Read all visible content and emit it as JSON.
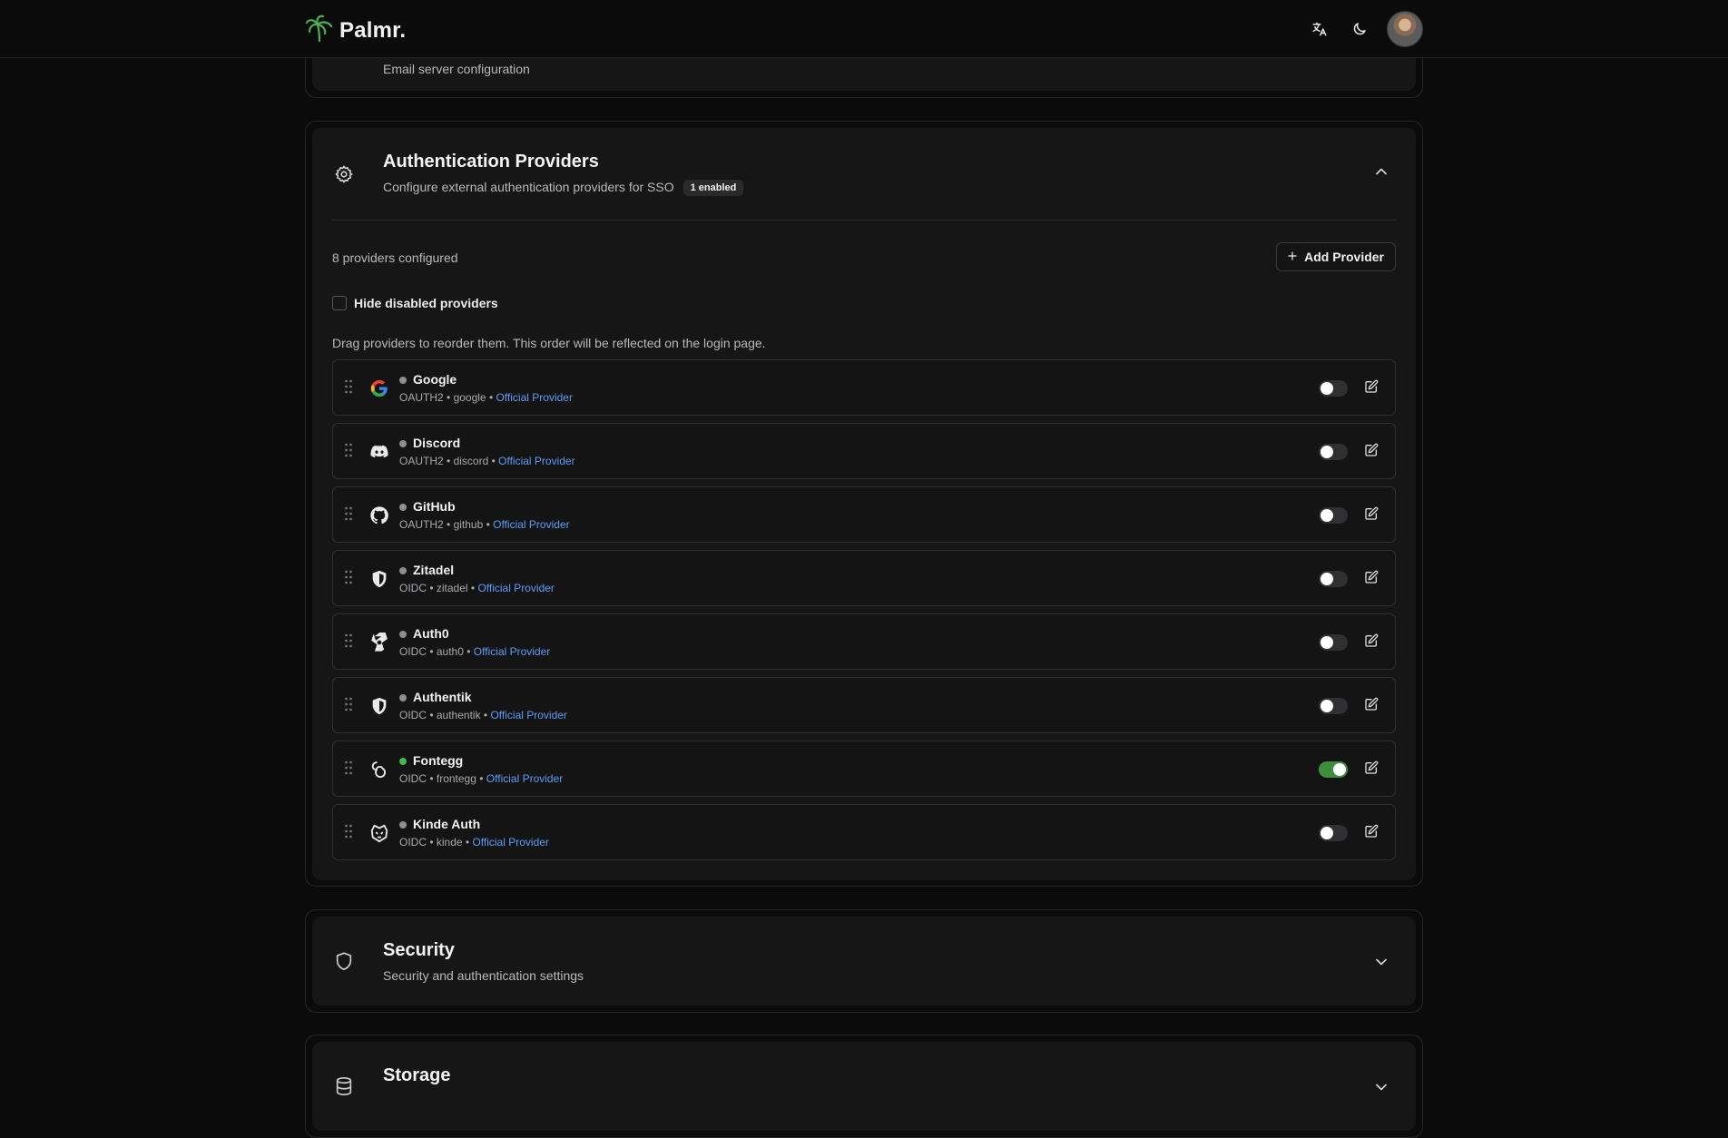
{
  "brand": {
    "name": "Palmr.",
    "logo_icon": "palm-tree-icon",
    "accent": "#4caf50"
  },
  "topbar": {
    "translate_icon": "translate-icon",
    "theme_icon": "moon-icon"
  },
  "email_section": {
    "subtitle": "Email server configuration"
  },
  "auth_section": {
    "title": "Authentication Providers",
    "subtitle": "Configure external authentication providers for SSO",
    "badge": "1 enabled",
    "count_text": "8 providers configured",
    "add_button": "Add Provider",
    "hide_disabled_label": "Hide disabled providers",
    "drag_hint": "Drag providers to reorder them. This order will be reflected on the login page.",
    "providers": [
      {
        "name": "Google",
        "protocol": "OAUTH2",
        "slug": "google",
        "link": "Official Provider",
        "icon": "google-icon",
        "enabled": false
      },
      {
        "name": "Discord",
        "protocol": "OAUTH2",
        "slug": "discord",
        "link": "Official Provider",
        "icon": "discord-icon",
        "enabled": false
      },
      {
        "name": "GitHub",
        "protocol": "OAUTH2",
        "slug": "github",
        "link": "Official Provider",
        "icon": "github-icon",
        "enabled": false
      },
      {
        "name": "Zitadel",
        "protocol": "OIDC",
        "slug": "zitadel",
        "link": "Official Provider",
        "icon": "shield-icon",
        "enabled": false
      },
      {
        "name": "Auth0",
        "protocol": "OIDC",
        "slug": "auth0",
        "link": "Official Provider",
        "icon": "auth0-icon",
        "enabled": false
      },
      {
        "name": "Authentik",
        "protocol": "OIDC",
        "slug": "authentik",
        "link": "Official Provider",
        "icon": "shield-icon",
        "enabled": false
      },
      {
        "name": "Fontegg",
        "protocol": "OIDC",
        "slug": "frontegg",
        "link": "Official Provider",
        "icon": "frontegg-icon",
        "enabled": true
      },
      {
        "name": "Kinde Auth",
        "protocol": "OIDC",
        "slug": "kinde",
        "link": "Official Provider",
        "icon": "kinde-icon",
        "enabled": false
      }
    ]
  },
  "security_section": {
    "title": "Security",
    "subtitle": "Security and authentication settings"
  },
  "storage_section": {
    "title": "Storage"
  },
  "colors": {
    "background": "#0b0b0c",
    "card": "#161617",
    "link": "#5b9cf6",
    "toggle_on": "#3e8e3e",
    "status_on": "#3fb950"
  }
}
